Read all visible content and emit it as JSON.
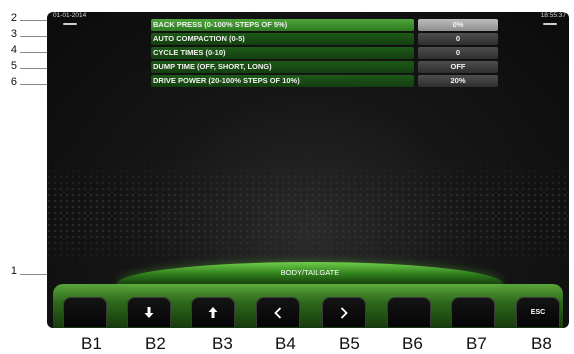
{
  "screen": {
    "date": "01-01-2014",
    "time": "18:55:37",
    "menu": [
      {
        "callout": "2",
        "label": "BACK PRESS (0-100% STEPS OF 5%)",
        "value": "0%",
        "selected": true
      },
      {
        "callout": "3",
        "label": "AUTO COMPACTION (0-5)",
        "value": "0",
        "selected": false
      },
      {
        "callout": "4",
        "label": "CYCLE TIMES (0-10)",
        "value": "0",
        "selected": false
      },
      {
        "callout": "5",
        "label": "DUMP TIME (OFF, SHORT, LONG)",
        "value": "OFF",
        "selected": false
      },
      {
        "callout": "6",
        "label": "DRIVE POWER (20-100% STEPS OF 10%)",
        "value": "20%",
        "selected": false
      }
    ],
    "title_callout": "1",
    "title": "BODY/TAILGATE",
    "softkeys": [
      {
        "name": "B1",
        "icon": "",
        "text": ""
      },
      {
        "name": "B2",
        "icon": "arrow-down-icon",
        "text": ""
      },
      {
        "name": "B3",
        "icon": "arrow-up-icon",
        "text": ""
      },
      {
        "name": "B4",
        "icon": "chevron-left-icon",
        "text": ""
      },
      {
        "name": "B5",
        "icon": "chevron-right-icon",
        "text": ""
      },
      {
        "name": "B6",
        "icon": "",
        "text": ""
      },
      {
        "name": "B7",
        "icon": "",
        "text": ""
      },
      {
        "name": "B8",
        "icon": "",
        "text": "ESC"
      }
    ]
  },
  "colors": {
    "accent_green": "#4fa53a",
    "row_green": "#1e5a18",
    "value_grey": "#3e3e3e",
    "selected_value": "#a6a6a6"
  }
}
